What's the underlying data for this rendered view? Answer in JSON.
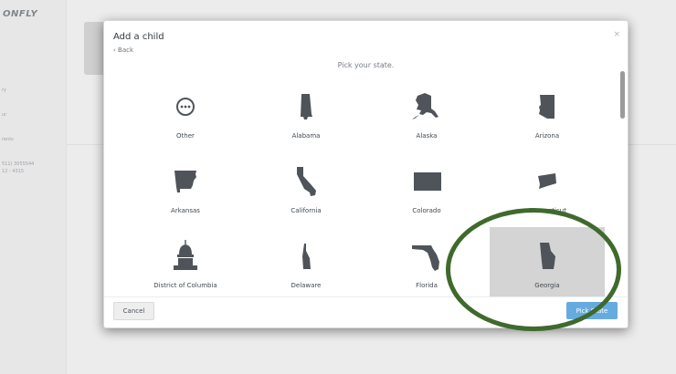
{
  "app": {
    "brand": "ONFLY",
    "nav": [
      "ry",
      "ur",
      "rents",
      "511) 3055544",
      "12 - 4315"
    ]
  },
  "modal": {
    "title": "Add a child",
    "back_label": "‹ Back",
    "close_label": "×",
    "subtitle": "Pick your state.",
    "cancel_label": "Cancel",
    "submit_label": "Pick State",
    "states": [
      {
        "label": "Other",
        "icon": "more-circle-icon",
        "selected": false
      },
      {
        "label": "Alabama",
        "icon": "alabama-icon",
        "selected": false
      },
      {
        "label": "Alaska",
        "icon": "alaska-icon",
        "selected": false
      },
      {
        "label": "Arizona",
        "icon": "arizona-icon",
        "selected": false
      },
      {
        "label": "Arkansas",
        "icon": "arkansas-icon",
        "selected": false
      },
      {
        "label": "California",
        "icon": "california-icon",
        "selected": false
      },
      {
        "label": "Colorado",
        "icon": "colorado-icon",
        "selected": false
      },
      {
        "label": "Connecticut",
        "icon": "connecticut-icon",
        "selected": false
      },
      {
        "label": "District of Columbia",
        "icon": "capitol-dome-icon",
        "selected": false
      },
      {
        "label": "Delaware",
        "icon": "delaware-icon",
        "selected": false
      },
      {
        "label": "Florida",
        "icon": "florida-icon",
        "selected": false
      },
      {
        "label": "Georgia",
        "icon": "georgia-icon",
        "selected": true
      }
    ]
  },
  "colors": {
    "icon_fill": "#4f545a",
    "selected_bg": "#d4d4d4",
    "primary_button": "#66abe0",
    "annotation": "#3f6a2c"
  }
}
